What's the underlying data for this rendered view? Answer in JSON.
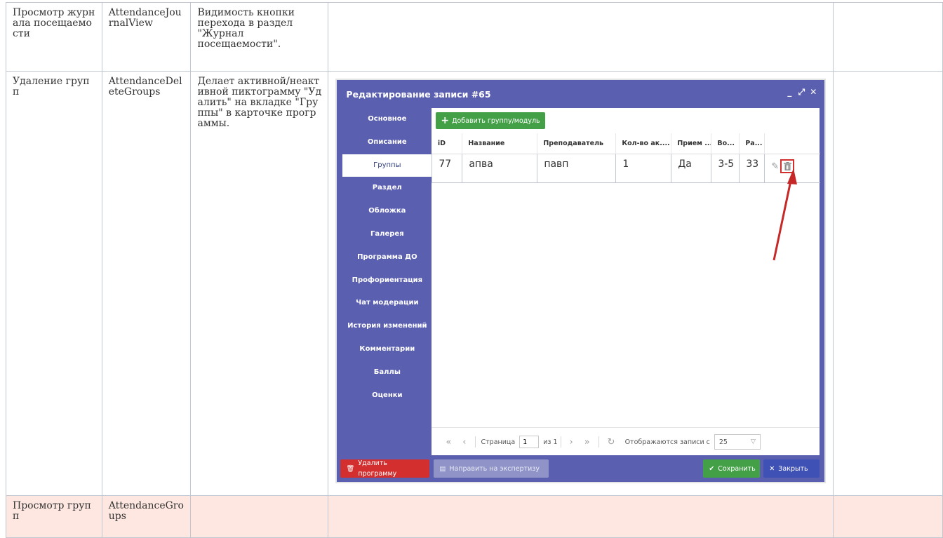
{
  "rows": [
    {
      "name": "Просмотр журнала посещаемости",
      "code": "AttendanceJournalView",
      "description": "Видимость кнопки перехода в раздел \"Журнал посещаемости\"."
    },
    {
      "name": "Удаление групп",
      "code": "AttendanceDeleteGroups",
      "description": "Делает активной/неактивной пиктограмму \"Удалить\" на вкладке \"Группы\" в карточке программы."
    },
    {
      "name": "Просмотр групп",
      "code": "AttendanceGroups",
      "description": ""
    }
  ],
  "dialog": {
    "title": "Редактирование записи #65",
    "tools": [
      "_",
      "⤢",
      "✕"
    ],
    "sidebar": [
      "Основное",
      "Описание",
      "Группы",
      "Раздел",
      "Обложка",
      "Галерея",
      "Программа ДО",
      "Профориентация",
      "Чат модерации",
      "История изменений",
      "Комментарии",
      "Баллы",
      "Оценки"
    ],
    "active_tab": "Группы",
    "add_button": "Добавить группу/модуль",
    "columns": [
      "iD",
      "Название",
      "Преподаватель",
      "Кол-во ак....",
      "Прием ...",
      "Во...",
      "Ра..."
    ],
    "grid_rows": [
      [
        "77",
        "апва",
        "павп",
        "1",
        "Да",
        "3-5",
        "33"
      ]
    ],
    "pager": {
      "page_label": "Страница",
      "page_value": "1",
      "of_label": "из 1",
      "display_label": "Отображаются записи с",
      "page_size": "25"
    },
    "buttons": {
      "delete_program": "Удалить программу",
      "send_expertise": "Направить на экспертизу",
      "save": "Сохранить",
      "close": "Закрыть"
    }
  },
  "colors": {
    "dialog_bg": "#5b5fb0",
    "accent_red": "#d32f2f",
    "accent_green": "#43a047",
    "row_highlight": "#fde7e0"
  }
}
